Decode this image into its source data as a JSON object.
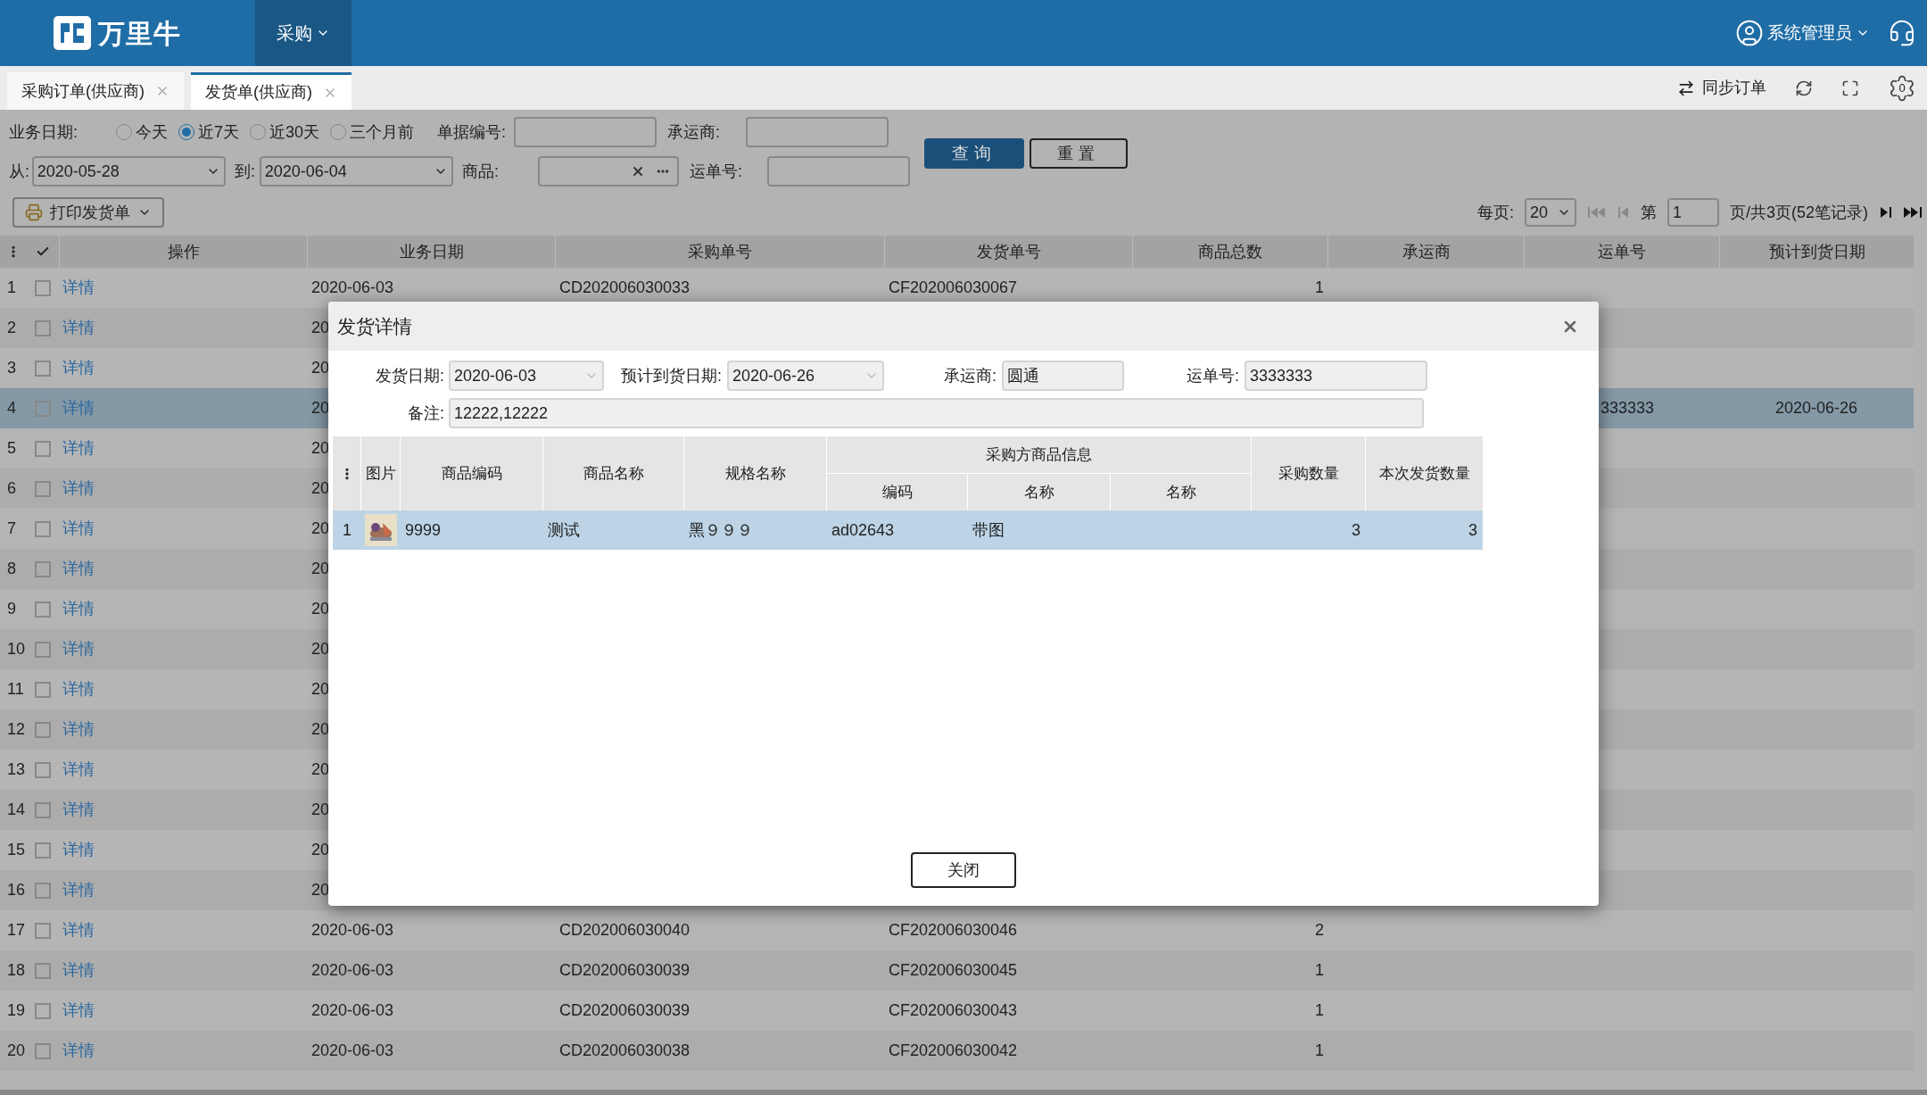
{
  "header": {
    "logo_text": "万里牛",
    "nav": [
      {
        "label": "采购",
        "selected": true
      }
    ],
    "user": "系统管理员"
  },
  "tabs": [
    {
      "label": "采购订单(供应商)",
      "selected": false
    },
    {
      "label": "发货单(供应商)",
      "selected": true
    }
  ],
  "toolbar": {
    "sync": "同步订单",
    "settings_badge": "0"
  },
  "filters": {
    "date_label": "业务日期:",
    "ranges": [
      {
        "label": "今天",
        "selected": false
      },
      {
        "label": "近7天",
        "selected": true
      },
      {
        "label": "近30天",
        "selected": false
      },
      {
        "label": "三个月前",
        "selected": false
      }
    ],
    "doc_no_label": "单据编号:",
    "carrier_label": "承运商:",
    "query": "查询",
    "reset": "重置",
    "from_label": "从:",
    "from": "2020-05-28",
    "to_label": "到:",
    "to": "2020-06-04",
    "product_label": "商品:",
    "waybill_label": "运单号:"
  },
  "print_button": "打印发货单",
  "pagination": {
    "per_page_label": "每页:",
    "per_page": "20",
    "page_label": "第",
    "page": "1",
    "summary": "页/共3页(52笔记录)"
  },
  "table": {
    "columns": [
      "操作",
      "业务日期",
      "采购单号",
      "发货单号",
      "商品总数",
      "承运商",
      "运单号",
      "预计到货日期"
    ],
    "rows": [
      {
        "index": "1",
        "checked": false,
        "selected": false,
        "link": "详情",
        "date": "2020-06-03",
        "purchase_no": "CD202006030033",
        "ship_no": "CF202006030067",
        "qty": "1"
      },
      {
        "index": "2",
        "checked": false,
        "selected": false,
        "link": "详情",
        "date": "20"
      },
      {
        "index": "3",
        "checked": false,
        "selected": false,
        "link": "详情",
        "date": "20"
      },
      {
        "index": "4",
        "checked": false,
        "selected": true,
        "link": "详情",
        "date": "20",
        "waybill": "333333",
        "eta": "2020-06-26"
      },
      {
        "index": "5",
        "checked": false,
        "selected": false,
        "link": "详情",
        "date": "20"
      },
      {
        "index": "6",
        "checked": false,
        "selected": false,
        "link": "详情",
        "date": "20"
      },
      {
        "index": "7",
        "checked": false,
        "selected": false,
        "link": "详情",
        "date": "20"
      },
      {
        "index": "8",
        "checked": false,
        "selected": false,
        "link": "详情",
        "date": "20"
      },
      {
        "index": "9",
        "checked": false,
        "selected": false,
        "link": "详情",
        "date": "20"
      },
      {
        "index": "10",
        "checked": false,
        "selected": false,
        "link": "详情",
        "date": "20"
      },
      {
        "index": "11",
        "checked": false,
        "selected": false,
        "link": "详情",
        "date": "20"
      },
      {
        "index": "12",
        "checked": false,
        "selected": false,
        "link": "详情",
        "date": "20"
      },
      {
        "index": "13",
        "checked": false,
        "selected": false,
        "link": "详情",
        "date": "20"
      },
      {
        "index": "14",
        "checked": false,
        "selected": false,
        "link": "详情",
        "date": "20"
      },
      {
        "index": "15",
        "checked": false,
        "selected": false,
        "link": "详情",
        "date": "20"
      },
      {
        "index": "16",
        "checked": false,
        "selected": false,
        "link": "详情",
        "date": "20"
      },
      {
        "index": "17",
        "checked": false,
        "selected": false,
        "link": "详情",
        "date": "2020-06-03",
        "purchase_no": "CD202006030040",
        "ship_no": "CF202006030046",
        "qty": "2"
      },
      {
        "index": "18",
        "checked": false,
        "selected": false,
        "link": "详情",
        "date": "2020-06-03",
        "purchase_no": "CD202006030039",
        "ship_no": "CF202006030045",
        "qty": "1"
      },
      {
        "index": "19",
        "checked": false,
        "selected": false,
        "link": "详情",
        "date": "2020-06-03",
        "purchase_no": "CD202006030039",
        "ship_no": "CF202006030043",
        "qty": "1"
      },
      {
        "index": "20",
        "checked": false,
        "selected": false,
        "link": "详情",
        "date": "2020-06-03",
        "purchase_no": "CD202006030038",
        "ship_no": "CF202006030042",
        "qty": "1"
      }
    ]
  },
  "dialog": {
    "title": "发货详情",
    "ship_date_label": "发货日期:",
    "ship_date": "2020-06-03",
    "eta_label": "预计到货日期:",
    "eta": "2020-06-26",
    "carrier_label": "承运商:",
    "carrier": "圆通",
    "waybill_label": "运单号:",
    "waybill": "3333333",
    "note_label": "备注:",
    "note": "12222,12222",
    "columns": {
      "picture": "图片",
      "code": "商品编码",
      "name": "商品名称",
      "spec": "规格名称",
      "group": "采购方商品信息",
      "buyer_code": "编码",
      "buyer_name": "名称",
      "buyer_name_2": "名称",
      "ordered": "采购数量",
      "shipped": "本次发货数量"
    },
    "rows": [
      {
        "index": "1",
        "selected": true,
        "code": "9999",
        "name": "测试",
        "spec": "黑９９９",
        "buyer_code": "ad02643",
        "buyer_name": "带图",
        "ordered": "3",
        "shipped": "3"
      }
    ],
    "close_button": "关闭"
  }
}
